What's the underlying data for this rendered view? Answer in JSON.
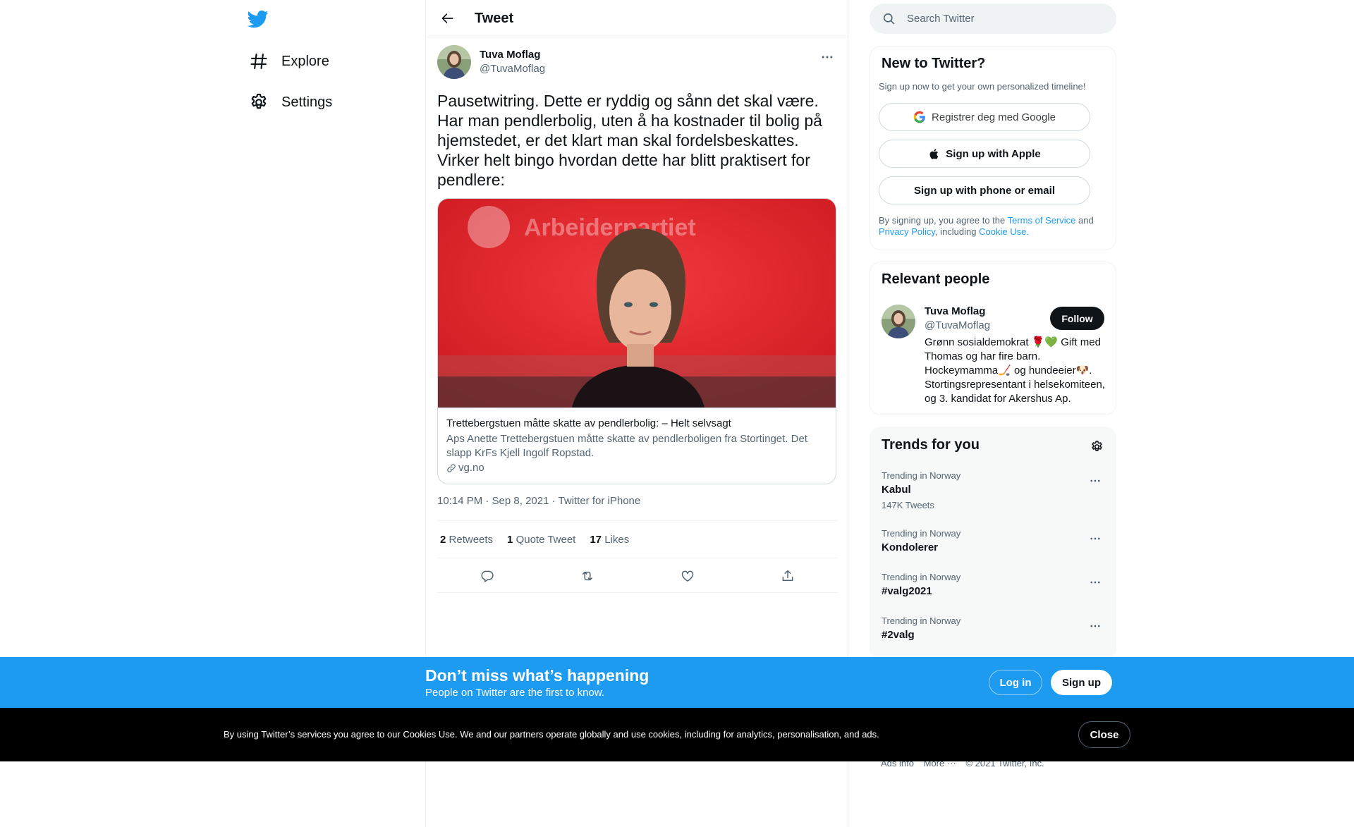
{
  "nav": {
    "items": [
      {
        "label": "Explore",
        "icon": "hashtag-icon"
      },
      {
        "label": "Settings",
        "icon": "gear-icon"
      }
    ]
  },
  "header": {
    "title": "Tweet"
  },
  "tweet": {
    "author_name": "Tuva Moflag",
    "author_handle": "@TuvaMoflag",
    "text": "Pausetwitring. Dette er ryddig og sånn det skal være. Har man pendlerbolig, uten å ha kostnader til bolig på hjemstedet, er det klart man skal fordelsbeskattes. Virker helt bingo hvordan dette har blitt praktisert for pendlere:",
    "card": {
      "image_banner_text": "Arbeiderpartiet",
      "title": "Trettebergstuen måtte skatte av pendlerbolig: – Helt selvsagt",
      "description": "Aps Anette Trettebergstuen måtte skatte av pendlerboligen fra Stortinget. Det slapp KrFs Kjell Ingolf Ropstad.",
      "domain": "vg.no"
    },
    "time": "10:14 PM · Sep 8, 2021",
    "separator": " · ",
    "source": "Twitter for iPhone",
    "stats": {
      "retweets_count": "2",
      "retweets_label": "Retweets",
      "quotes_count": "1",
      "quotes_label": "Quote Tweet",
      "likes_count": "17",
      "likes_label": "Likes"
    }
  },
  "search": {
    "placeholder": "Search Twitter"
  },
  "new_to_twitter": {
    "title": "New to Twitter?",
    "subtitle": "Sign up now to get your own personalized timeline!",
    "google_label": "Registrer deg med Google",
    "apple_label": "Sign up with Apple",
    "phone_label": "Sign up with phone or email",
    "terms_prefix": "By signing up, you agree to the ",
    "terms_link": "Terms of Service",
    "terms_and": " and ",
    "privacy_link": "Privacy Policy",
    "terms_including": ", including ",
    "cookie_link": "Cookie Use."
  },
  "relevant": {
    "title": "Relevant people",
    "name": "Tuva Moflag",
    "handle": "@TuvaMoflag",
    "follow_label": "Follow",
    "bio": "Grønn sosialdemokrat 🌹💚 Gift med Thomas og har fire barn. Hockeymamma🏒 og hundeeier🐶. Stortingsrepresentant i helsekomiteen, og 3. kandidat for Akershus Ap."
  },
  "trends": {
    "title": "Trends for you",
    "items": [
      {
        "context": "Trending in Norway",
        "name": "Kabul",
        "count": "147K Tweets"
      },
      {
        "context": "Trending in Norway",
        "name": "Kondolerer",
        "count": ""
      },
      {
        "context": "Trending in Norway",
        "name": "#valg2021",
        "count": ""
      },
      {
        "context": "Trending in Norway",
        "name": "#2valg",
        "count": ""
      }
    ]
  },
  "footer": {
    "ads_info": "Ads info",
    "more": "More ···",
    "copyright": "© 2021 Twitter, Inc."
  },
  "bottom_bar": {
    "title": "Don’t miss what’s happening",
    "subtitle": "People on Twitter are the first to know.",
    "login_label": "Log in",
    "signup_label": "Sign up"
  },
  "cookie_bar": {
    "text": "By using Twitter’s services you agree to our Cookies Use. We and our partners operate globally and use cookies, including for analytics, personalisation, and ads.",
    "close_label": "Close"
  },
  "colors": {
    "accent": "#1d9bf0",
    "text": "#0f1419",
    "muted": "#536471",
    "card_red": "#e8202a"
  }
}
